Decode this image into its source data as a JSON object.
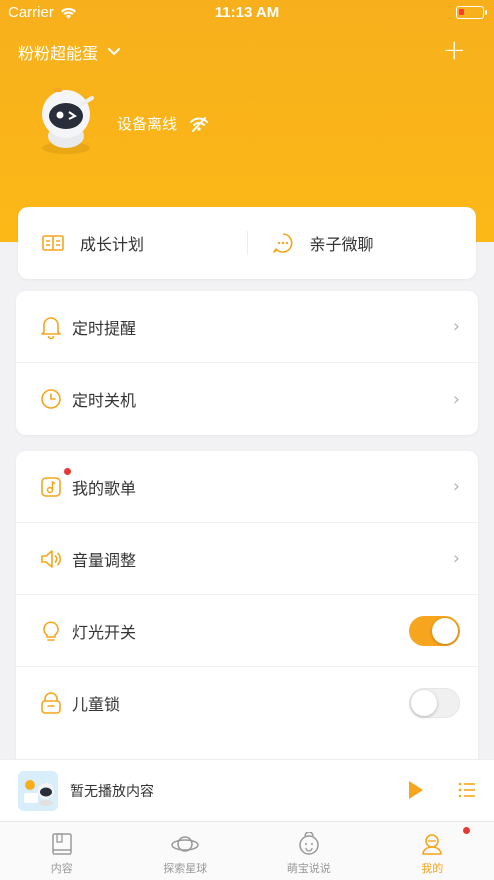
{
  "status_bar": {
    "carrier": "Carrier",
    "time": "11:13 AM"
  },
  "header": {
    "device_name": "粉粉超能蛋",
    "device_status": "设备离线"
  },
  "quick_actions": [
    {
      "label": "成长计划",
      "icon": "book-icon"
    },
    {
      "label": "亲子微聊",
      "icon": "chat-icon"
    }
  ],
  "timer_section": [
    {
      "label": "定时提醒",
      "icon": "bell-icon"
    },
    {
      "label": "定时关机",
      "icon": "clock-icon"
    }
  ],
  "settings_section": [
    {
      "label": "我的歌单",
      "icon": "music-list-icon",
      "badge": true
    },
    {
      "label": "音量调整",
      "icon": "speaker-icon"
    },
    {
      "label": "灯光开关",
      "icon": "bulb-icon",
      "toggle": true
    },
    {
      "label": "儿童锁",
      "icon": "lock-icon",
      "toggle": false
    }
  ],
  "player": {
    "title": "暂无播放内容"
  },
  "tabbar": [
    {
      "label": "内容",
      "icon": "book-tab-icon"
    },
    {
      "label": "探索星球",
      "icon": "planet-icon"
    },
    {
      "label": "萌宝说说",
      "icon": "baby-icon"
    },
    {
      "label": "我的",
      "icon": "profile-icon",
      "active": true,
      "badge": true
    }
  ],
  "colors": {
    "accent": "#f7a51d",
    "header": "#fcb817",
    "badge": "#e53935"
  }
}
